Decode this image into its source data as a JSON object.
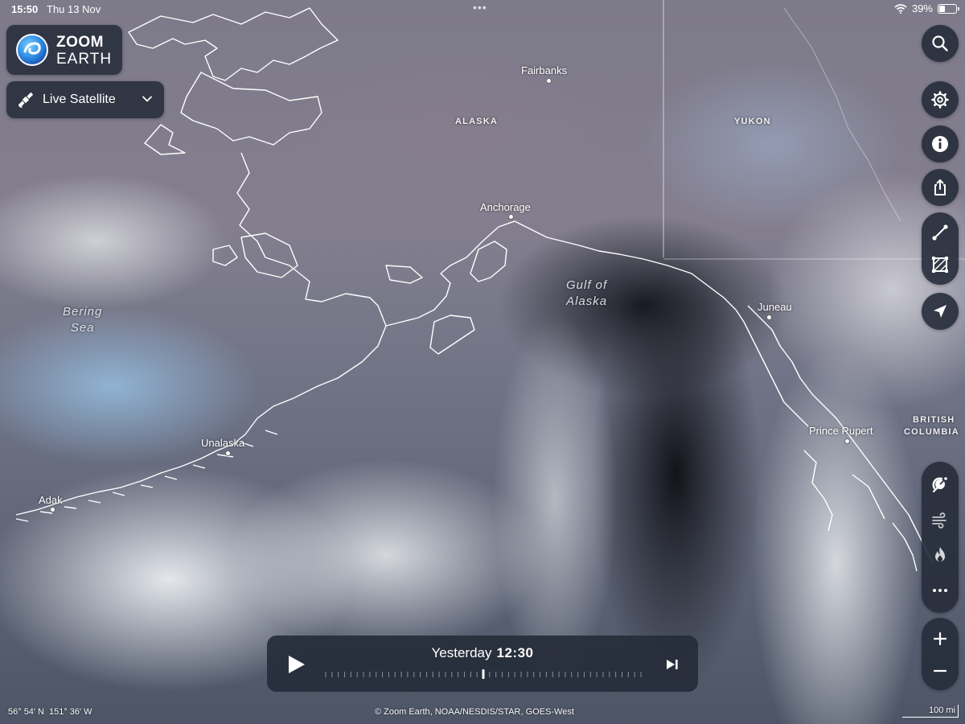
{
  "status_bar": {
    "time": "15:50",
    "date": "Thu 13 Nov",
    "battery": "39%",
    "battery_level": 0.39
  },
  "app": {
    "logo_line1": "ZOOM",
    "logo_line2": "EARTH",
    "layer_selector": "Live Satellite"
  },
  "map": {
    "regions": [
      "ALASKA",
      "YUKON",
      "BRITISH",
      "COLUMBIA"
    ],
    "seas": {
      "bering": [
        "Bering",
        "Sea"
      ],
      "gulf": [
        "Gulf of",
        "Alaska"
      ]
    },
    "cities": [
      "Fairbanks",
      "Anchorage",
      "Juneau",
      "Prince Rupert",
      "Unalaska",
      "Adak"
    ]
  },
  "timeline": {
    "day": "Yesterday",
    "time": "12:30",
    "position": 0.5
  },
  "footer": {
    "lat": "56° 54′ N",
    "lon": "151° 36′ W",
    "attribution": "© Zoom Earth, NOAA/NESDIS/STAR, GOES-West",
    "scale": "100 mi"
  },
  "colors": {
    "panel_bg": "#262c3a",
    "accent_blue": "#2e8be6",
    "coastline": "#ffffff"
  },
  "icons": {
    "search": "search-icon",
    "settings": "gear-icon",
    "info": "info-icon",
    "share": "share-icon",
    "measure_distance": "measure-line-icon",
    "measure_area": "measure-area-icon",
    "locate": "location-arrow-icon",
    "radar": "radar-icon",
    "wind": "wind-icon",
    "fire": "fire-icon",
    "more": "more-icon",
    "zoom_in": "plus-icon",
    "zoom_out": "minus-icon"
  }
}
